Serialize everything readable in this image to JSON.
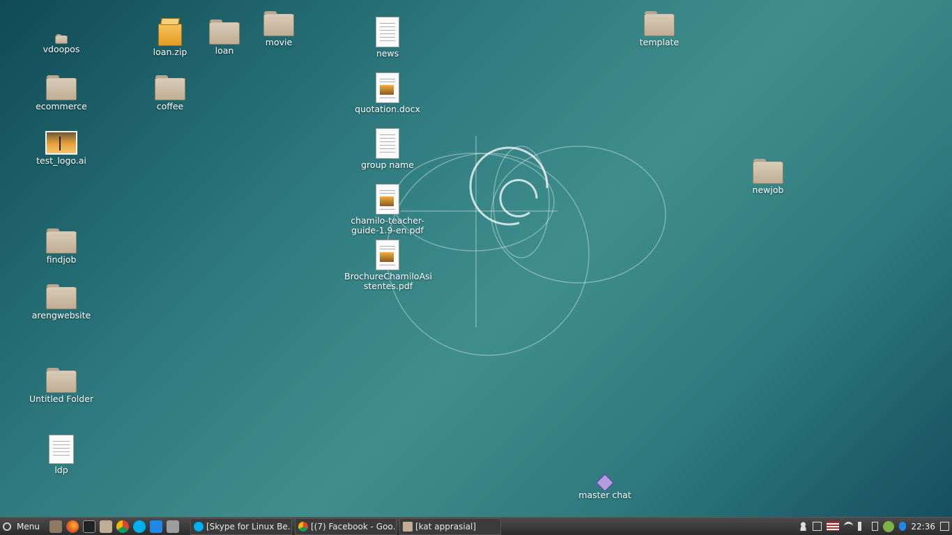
{
  "desktop": {
    "icons": [
      {
        "label": "vdoopos",
        "type": "folder-small"
      },
      {
        "label": "loan.zip",
        "type": "zip"
      },
      {
        "label": "loan",
        "type": "folder"
      },
      {
        "label": "movie",
        "type": "folder"
      },
      {
        "label": "news",
        "type": "document"
      },
      {
        "label": "template",
        "type": "folder"
      },
      {
        "label": "ecommerce",
        "type": "folder"
      },
      {
        "label": "coffee",
        "type": "folder"
      },
      {
        "label": "quotation.docx",
        "type": "document-image"
      },
      {
        "label": "test_logo.ai",
        "type": "image"
      },
      {
        "label": "group name",
        "type": "document"
      },
      {
        "label": "newjob",
        "type": "folder"
      },
      {
        "label": "chamilo-teacher-guide-1.9-en.pdf",
        "type": "document-image"
      },
      {
        "label": "findjob",
        "type": "folder"
      },
      {
        "label": "BrochureChamiloAsistentes.pdf",
        "type": "document-image"
      },
      {
        "label": "arengwebsite",
        "type": "folder"
      },
      {
        "label": "Untitled Folder",
        "type": "folder"
      },
      {
        "label": "ldp",
        "type": "document"
      },
      {
        "label": "master chat",
        "type": "chat-launcher"
      }
    ]
  },
  "taskbar": {
    "menu_label": "Menu",
    "launchers": [
      "show-desktop-icon",
      "firefox-icon",
      "terminal-icon",
      "files-icon",
      "chrome-icon",
      "skype-icon",
      "vscode-icon",
      "screenshot-icon"
    ],
    "tasks": [
      {
        "label": "[Skype for Linux Be..."
      },
      {
        "label": "[(7) Facebook - Goo..."
      },
      {
        "label": "[kat apprasial]"
      }
    ],
    "tray": [
      "user-icon",
      "clipboard-icon",
      "us-flag-icon",
      "wifi-icon",
      "volume-icon",
      "battery-icon",
      "update-check-icon",
      "bluetooth-icon"
    ],
    "clock": "22:36"
  },
  "colors": {
    "wallpaper": "#3f8e8c",
    "taskbar": "#333333"
  }
}
